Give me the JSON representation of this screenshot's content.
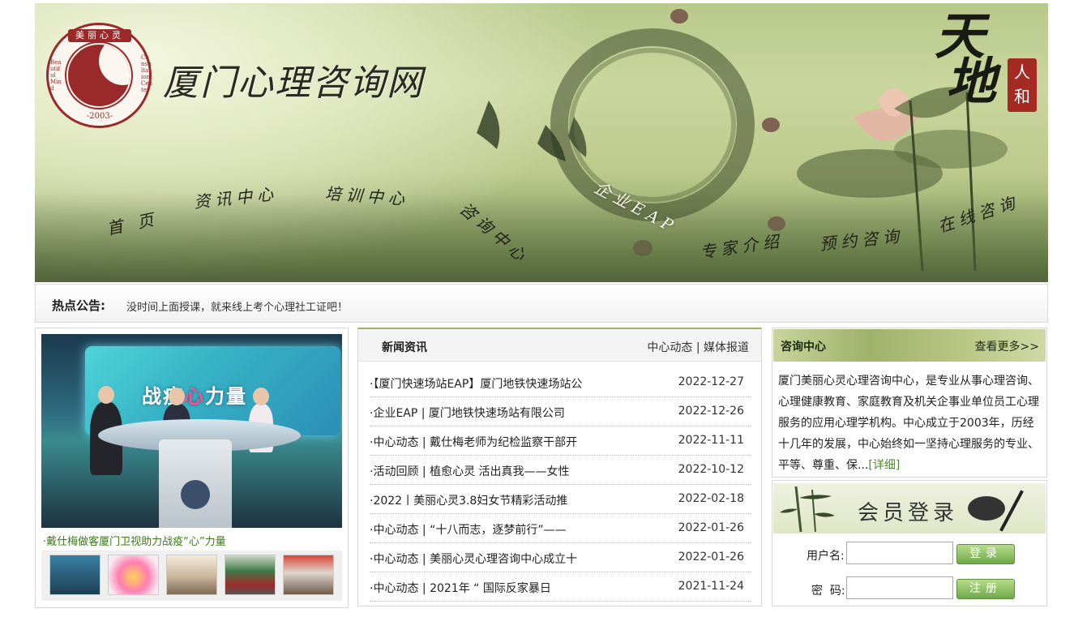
{
  "banner": {
    "logo": {
      "top_text": "美丽心灵",
      "year": "-2003-",
      "left_text": "Beautiful Mind",
      "right_text": "Consultation Center"
    },
    "site_title": "厦门心理咨询网",
    "motto": {
      "big1": "天",
      "big2": "地",
      "seal1": "人",
      "seal2": "和"
    },
    "nav": [
      "首 页",
      "资讯中心",
      "培训中心",
      "咨询中心",
      "企业EAP",
      "专家介绍",
      "预约咨询",
      "在线咨询"
    ]
  },
  "notice": {
    "label": "热点公告:",
    "text": "没时间上面授课，就来线上考个心理社工证吧！"
  },
  "feature": {
    "screen_title_a": "战疫",
    "screen_title_heart": "心",
    "screen_title_b": "力量",
    "caption": "·戴仕梅做客厦门卫视助力战疫“心”力量"
  },
  "news": {
    "title": "新闻资讯",
    "links": [
      "中心动态",
      "媒体报道"
    ],
    "items": [
      {
        "title": "·【厦门快速场站EAP】厦门地铁快速场站公",
        "date": "2022-12-27"
      },
      {
        "title": "·企业EAP | 厦门地铁快速场站有限公司",
        "date": "2022-12-26"
      },
      {
        "title": "·中心动态 | 戴仕梅老师为纪检监察干部开",
        "date": "2022-11-11"
      },
      {
        "title": "·活动回顾 | 植愈心灵 活出真我——女性",
        "date": "2022-10-12"
      },
      {
        "title": "·2022丨美丽心灵3.8妇女节精彩活动推",
        "date": "2022-02-18"
      },
      {
        "title": "·中心动态 | “十八而志，逐梦前行”——",
        "date": "2022-01-26"
      },
      {
        "title": "·中心动态 | 美丽心灵心理咨询中心成立十",
        "date": "2022-01-26"
      },
      {
        "title": "·中心动态 | 2021年 “ 国际反家暴日",
        "date": "2021-11-24"
      }
    ]
  },
  "consult": {
    "title": "咨询中心",
    "more": "查看更多>>",
    "body": "厦门美丽心灵心理咨询中心，是专业从事心理咨询、心理健康教育、家庭教育及机关企事业单位员工心理服务的应用心理学机构。中心成立于2003年，历经十几年的发展，中心始终如一坚持心理服务的专业、平等、尊重、保...",
    "detail": "[详细]"
  },
  "login": {
    "title": "会员登录",
    "username_label": "用户名:",
    "password_label": "密  码:",
    "login_button": "登录",
    "register_button": "注册"
  }
}
